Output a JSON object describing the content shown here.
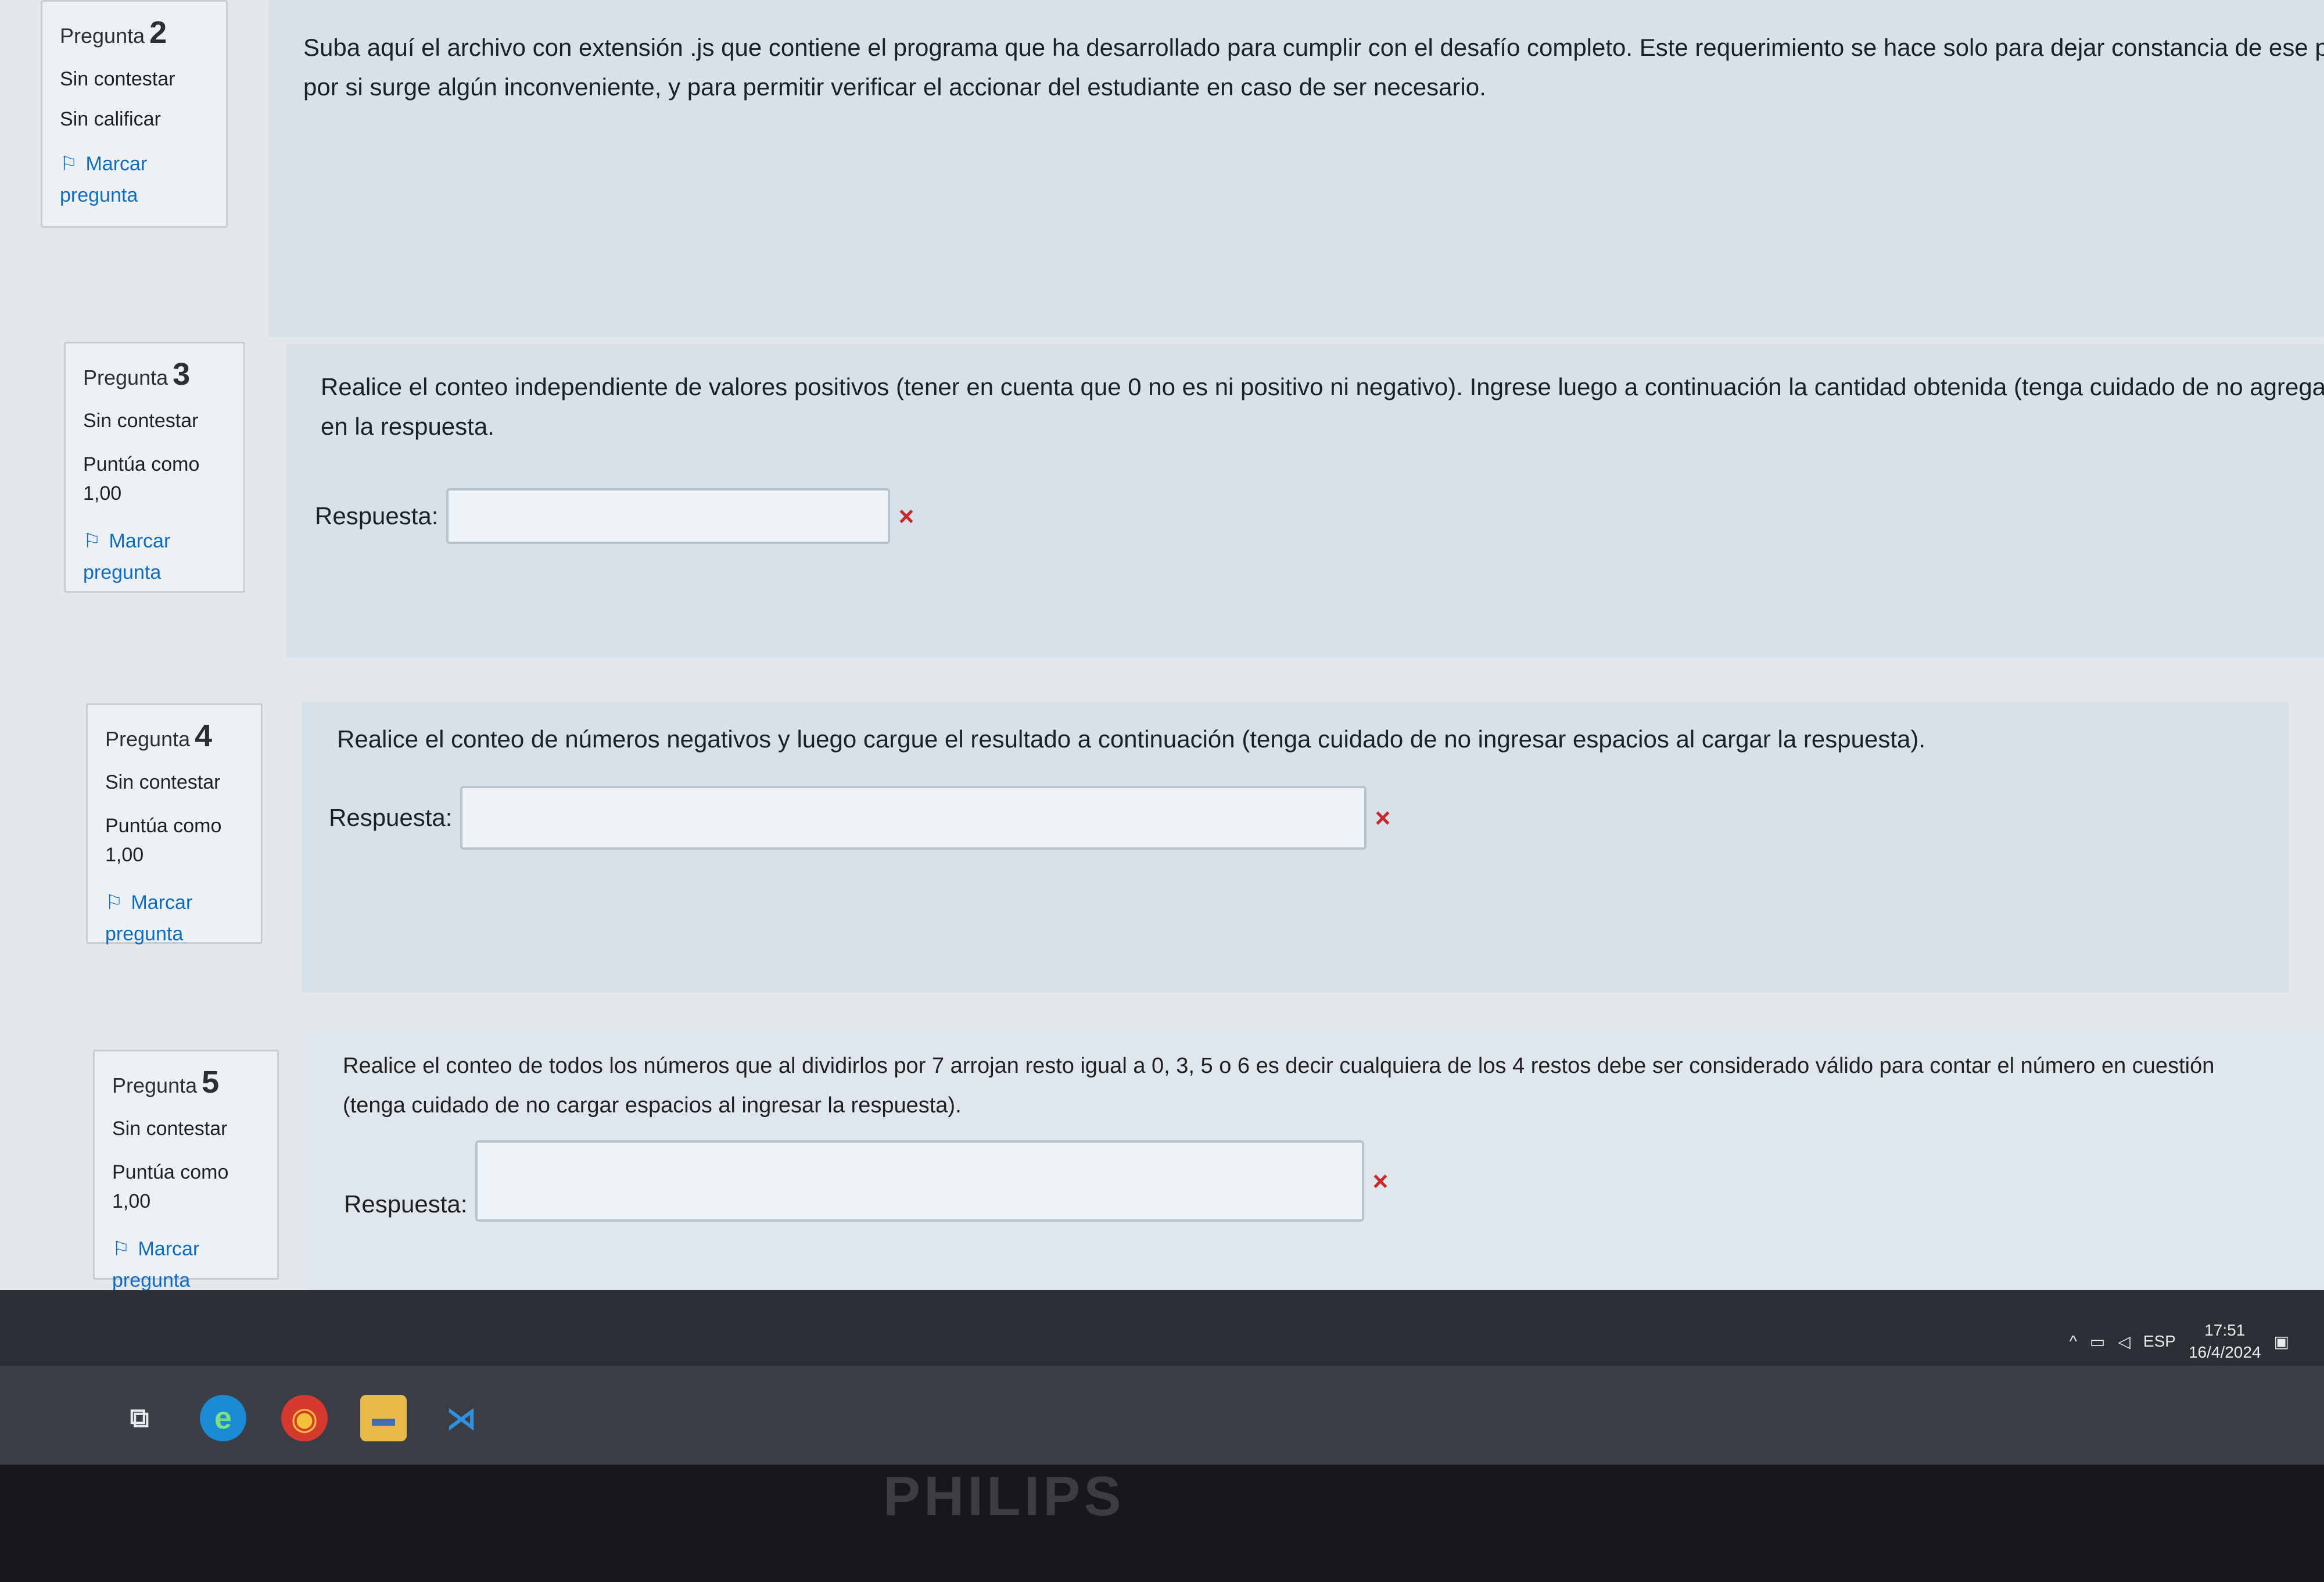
{
  "questions": [
    {
      "label": "Pregunta",
      "number": "2",
      "state": "Sin contestar",
      "grade": "Sin calificar",
      "flag_line1": "Marcar",
      "flag_line2": "pregunta",
      "text1": "Suba aquí el archivo con extensión .js que contiene el programa que ha desarrollado para cumplir con el desafío completo. Este requerimiento se hace solo para dejar constancia de ese programa,",
      "text2": "por si surge algún inconveniente, y para permitir verificar el accionar del estudiante en caso de ser necesario."
    },
    {
      "label": "Pregunta",
      "number": "3",
      "state": "Sin contestar",
      "grade_line1": "Puntúa como",
      "grade_line2": "1,00",
      "flag_line1": "Marcar",
      "flag_line2": "pregunta",
      "text1": "Realice el conteo independiente de valores positivos (tener en cuenta que 0 no es ni positivo ni negativo). Ingrese luego a continuación la cantidad obtenida (tenga cuidado de no agregar espacios",
      "text2": "en la respuesta.",
      "answer_label": "Respuesta:",
      "answer_value": "",
      "mark": "×"
    },
    {
      "label": "Pregunta",
      "number": "4",
      "state": "Sin contestar",
      "grade_line1": "Puntúa como",
      "grade_line2": "1,00",
      "flag_line1": "Marcar",
      "flag_line2": "pregunta",
      "text1": "Realice el conteo de números negativos y luego cargue el resultado a continuación (tenga cuidado de no ingresar espacios al cargar la respuesta).",
      "answer_label": "Respuesta:",
      "answer_value": "",
      "mark": "×"
    },
    {
      "label": "Pregunta",
      "number": "5",
      "state": "Sin contestar",
      "grade_line1": "Puntúa como",
      "grade_line2": "1,00",
      "flag_line1": "Marcar",
      "flag_line2": "pregunta",
      "text1": "Realice el conteo de todos los números que al dividirlos por 7 arrojan resto igual a 0, 3, 5 o 6 es decir cualquiera de los 4 restos debe ser considerado válido para contar el número en cuestión",
      "text2": "(tenga cuidado de no cargar espacios al ingresar la respuesta).",
      "answer_label": "Respuesta:",
      "answer_value": "",
      "mark": "×"
    }
  ],
  "tray": {
    "lang": "ESP",
    "time": "17:51",
    "date": "16/4/2024"
  },
  "monitor_brand": "PHILIPS",
  "colors": {
    "accent": "#0f6cbf",
    "error": "#c52b2b",
    "content_bg": "#d6e1e9"
  }
}
